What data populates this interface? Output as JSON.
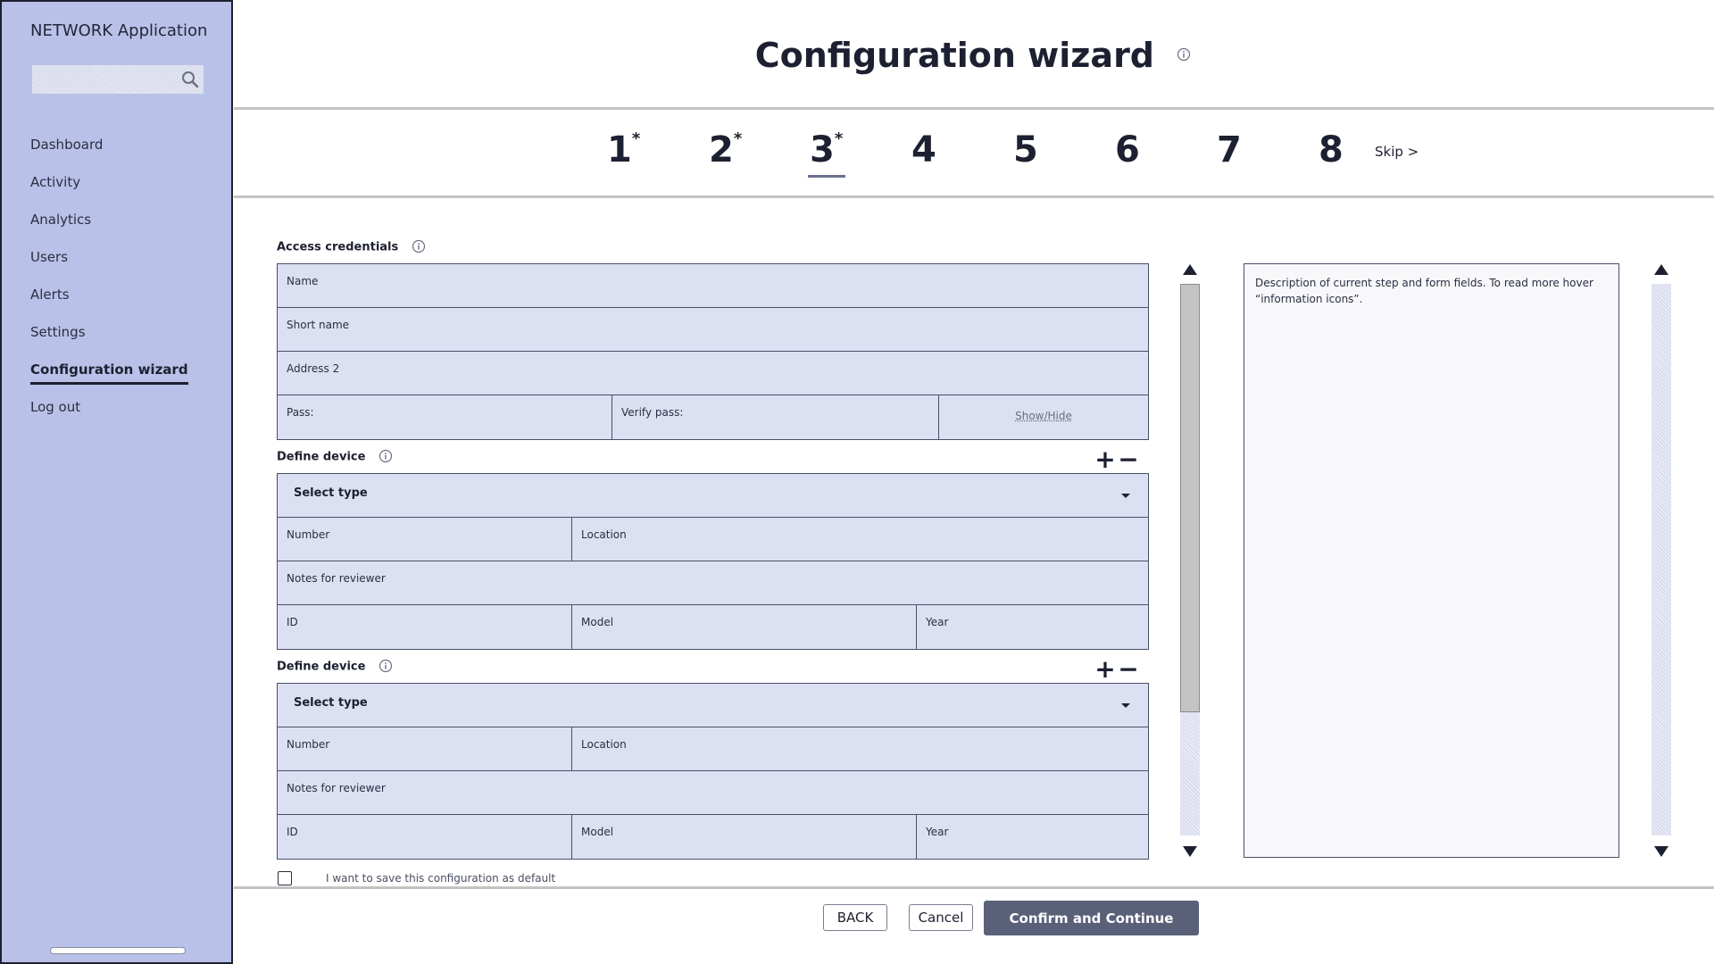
{
  "sidebar": {
    "app_title": "NETWORK Application",
    "search": {
      "value": "",
      "placeholder": ""
    },
    "items": [
      {
        "label": "Dashboard",
        "active": false
      },
      {
        "label": "Activity",
        "active": false
      },
      {
        "label": "Analytics",
        "active": false
      },
      {
        "label": "Users",
        "active": false
      },
      {
        "label": "Alerts",
        "active": false
      },
      {
        "label": "Settings",
        "active": false
      },
      {
        "label": "Configuration wizard",
        "active": true
      },
      {
        "label": "Log out",
        "active": false
      }
    ]
  },
  "header": {
    "title": "Configuration wizard",
    "info_icon": "info-icon"
  },
  "steps": {
    "items": [
      {
        "number": "1",
        "marker": "*"
      },
      {
        "number": "2",
        "marker": "*"
      },
      {
        "number": "3",
        "marker": "*",
        "current": true
      },
      {
        "number": "4",
        "marker": ""
      },
      {
        "number": "5",
        "marker": ""
      },
      {
        "number": "6",
        "marker": ""
      },
      {
        "number": "7",
        "marker": ""
      },
      {
        "number": "8",
        "marker": ""
      }
    ],
    "skip_label": "Skip >"
  },
  "access_credentials": {
    "label": "Access credentials",
    "fields": {
      "name": "Name",
      "short_name": "Short name",
      "address2": "Address 2",
      "pass": "Pass:",
      "verify_pass": "Verify pass:",
      "show_hide": "Show/Hide"
    }
  },
  "devices": [
    {
      "label": "Define device",
      "add": "+",
      "remove": "−",
      "select_type": "Select type",
      "fields": {
        "number": "Number",
        "location": "Location",
        "notes": "Notes for reviewer",
        "id": "ID",
        "model": "Model",
        "year": "Year"
      }
    },
    {
      "label": "Define device",
      "add": "+",
      "remove": "−",
      "select_type": "Select type",
      "fields": {
        "number": "Number",
        "location": "Location",
        "notes": "Notes for reviewer",
        "id": "ID",
        "model": "Model",
        "year": "Year"
      }
    }
  ],
  "description": {
    "text": "Description of current step and form fields. To read more hover “information icons”."
  },
  "save_default": {
    "label": "I want to save this configuration as default",
    "checked": false
  },
  "footer": {
    "back": "BACK",
    "cancel": "Cancel",
    "confirm": "Confirm and Continue"
  },
  "colors": {
    "sidebar_bg": "#b9c1e8",
    "field_bg": "#dce0f3",
    "primary_button": "#5a6078",
    "text": "#1d2030"
  }
}
